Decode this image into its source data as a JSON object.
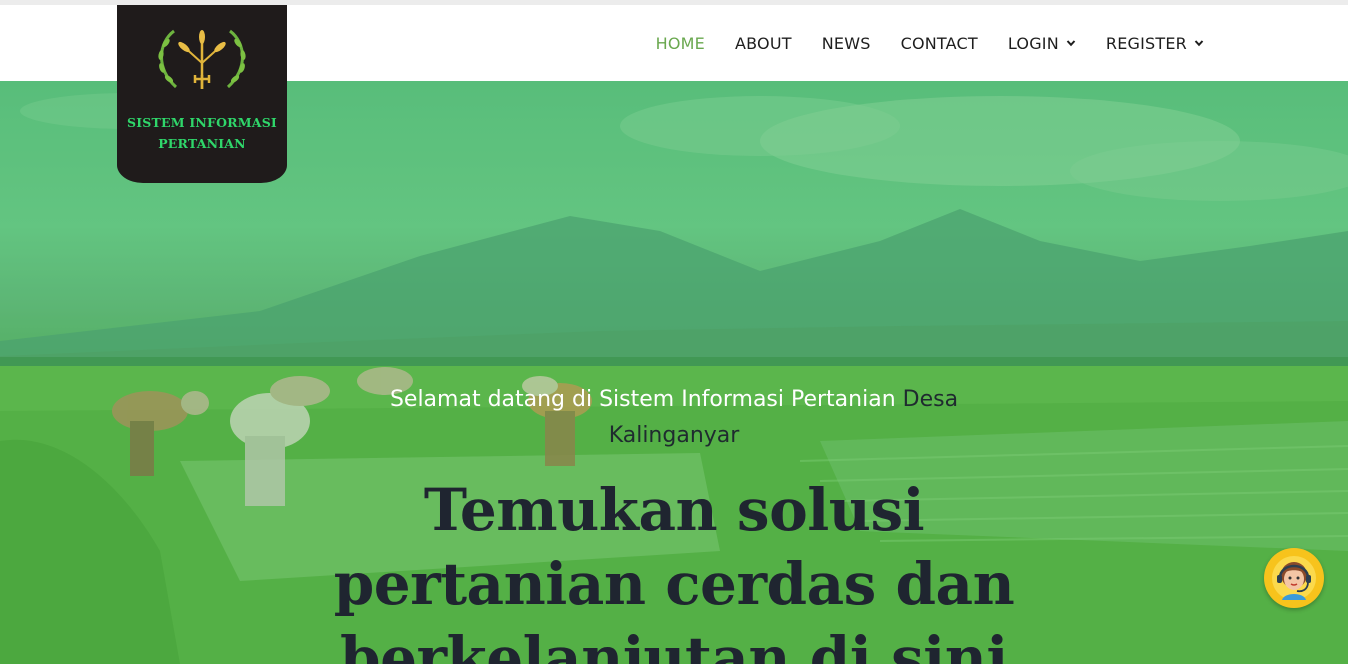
{
  "brand": {
    "line1": "SISTEM INFORMASI",
    "line2": "PERTANIAN",
    "emblem_icon": "wheat-wreath-icon",
    "bg_color": "#1f1b1b",
    "text_color": "#2fd66a"
  },
  "nav": {
    "items": [
      {
        "label": "HOME",
        "active": true
      },
      {
        "label": "ABOUT",
        "active": false
      },
      {
        "label": "NEWS",
        "active": false
      },
      {
        "label": "CONTACT",
        "active": false
      },
      {
        "label": "LOGIN",
        "active": false,
        "dropdown": true
      },
      {
        "label": "REGISTER",
        "active": false,
        "dropdown": true
      }
    ],
    "active_color": "#6aa84f"
  },
  "hero": {
    "welcome_prefix": "Selamat datang di Sistem Informasi Pertanian",
    "welcome_highlight_1": "Desa",
    "welcome_highlight_2": "Kalinganyar",
    "headline_line1": "Temukan solusi",
    "headline_line2": "pertanian cerdas dan",
    "headline_line3": "berkelanjutan di sini",
    "background": "rice-field-farmers-photo"
  },
  "chat": {
    "icon": "customer-support-agent-icon",
    "color": "#f7c31c"
  }
}
